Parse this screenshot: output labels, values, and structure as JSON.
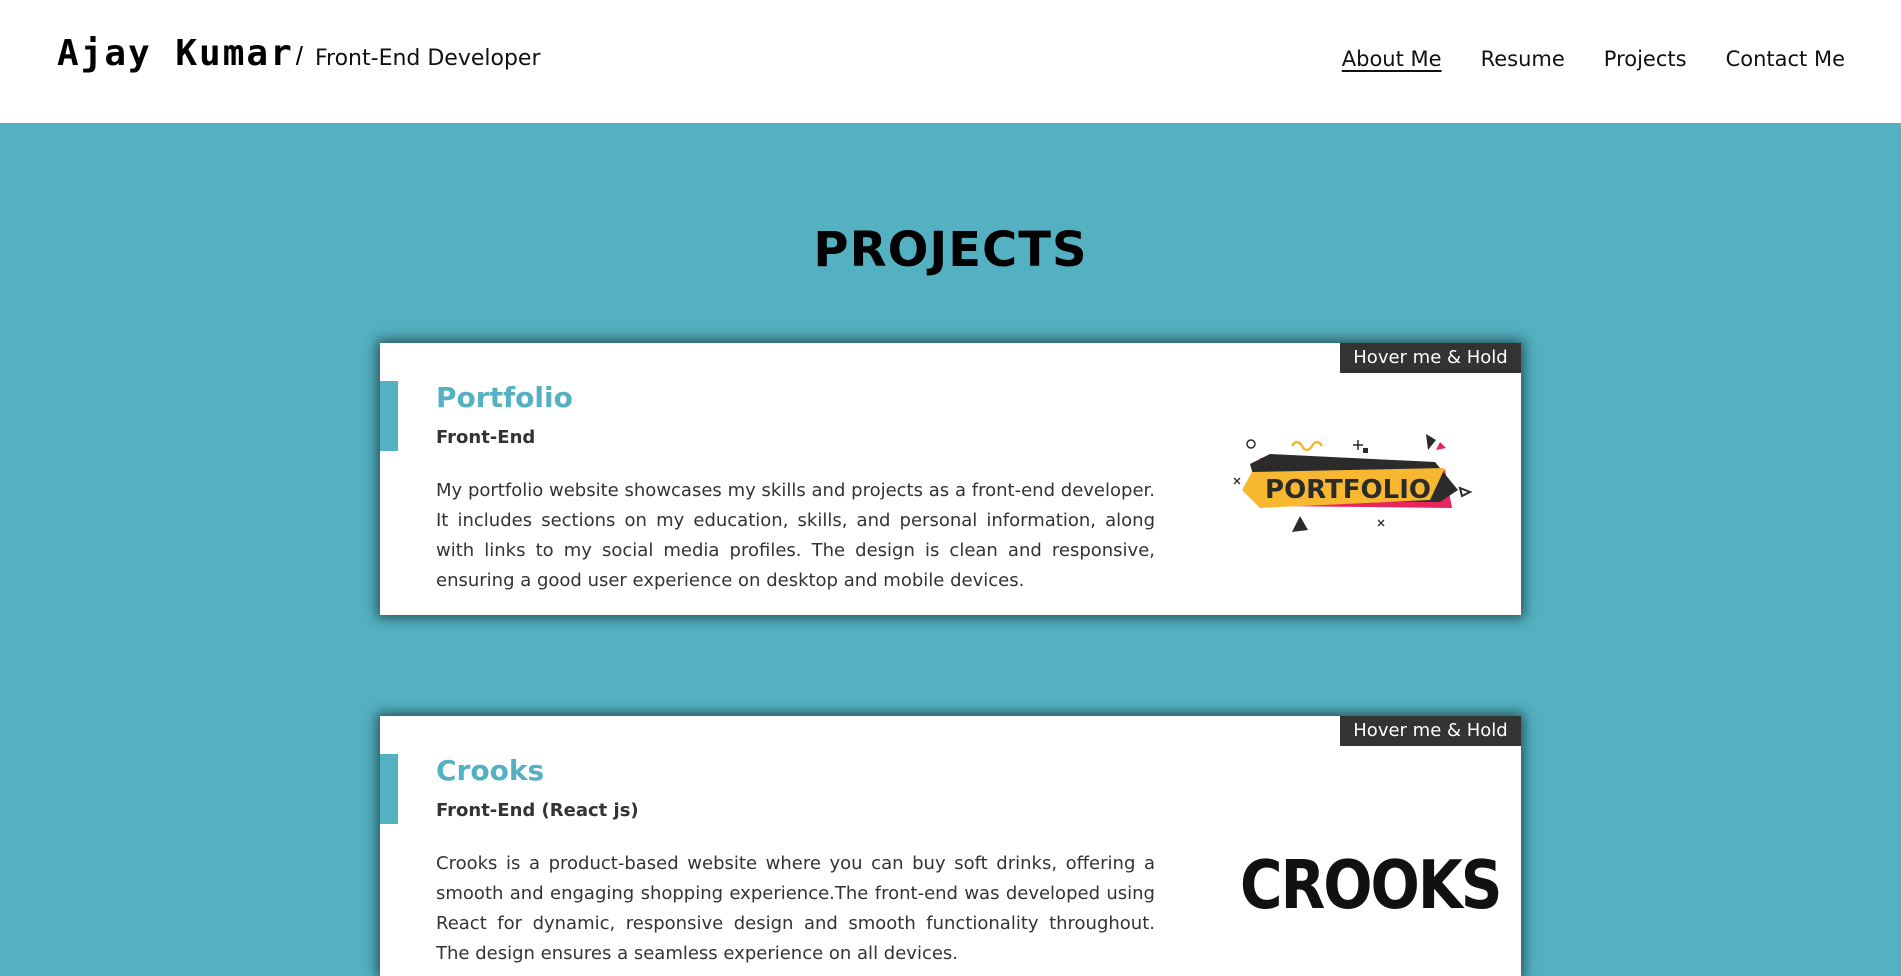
{
  "header": {
    "name": "Ajay Kumar",
    "separator": "/",
    "role": "Front-End Developer",
    "nav": [
      {
        "label": "About Me",
        "active": true
      },
      {
        "label": "Resume",
        "active": false
      },
      {
        "label": "Projects",
        "active": false
      },
      {
        "label": "Contact Me",
        "active": false
      }
    ]
  },
  "section_title": "PROJECTS",
  "colors": {
    "accent": "#53b1c1",
    "tag_bg": "#333333",
    "logo_yellow": "#f7b731",
    "logo_pink": "#e8265e",
    "logo_dark": "#2b2b2b"
  },
  "projects": [
    {
      "tag": "Hover me & Hold",
      "title": "Portfolio",
      "subtitle": "Front-End",
      "description": "My portfolio website showcases my skills and projects as a front-end developer. It includes sections on my education, skills, and personal information, along with links to my social media profiles. The design is clean and responsive, ensuring a good user experience on desktop and mobile devices.",
      "logo_text": "PORTFOLIO"
    },
    {
      "tag": "Hover me & Hold",
      "title": "Crooks",
      "subtitle": "Front-End (React js)",
      "description": "Crooks is a product-based website where you can buy soft drinks, offering a smooth and engaging shopping experience.The front-end was developed using React for dynamic, responsive design and smooth functionality throughout. The design ensures a seamless experience on all devices.",
      "logo_text": "CROOKS"
    }
  ]
}
